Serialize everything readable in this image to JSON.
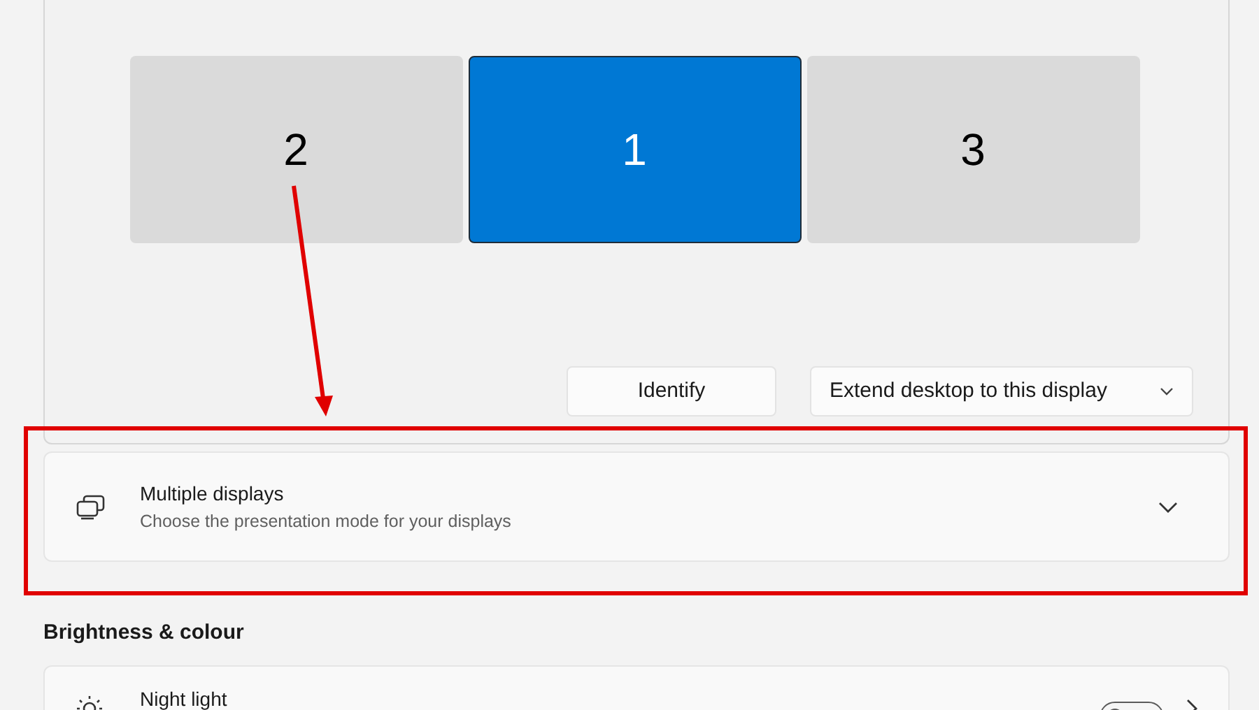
{
  "displays": [
    {
      "label": "2",
      "selected": false
    },
    {
      "label": "1",
      "selected": true
    },
    {
      "label": "3",
      "selected": false
    }
  ],
  "identify_button": "Identify",
  "display_mode_dropdown": "Extend desktop to this display",
  "multiple_displays": {
    "title": "Multiple displays",
    "subtitle": "Choose the presentation mode for your displays",
    "expanded": false
  },
  "section_heading": "Brightness & colour",
  "night_light": {
    "title": "Night light",
    "on": false
  }
}
